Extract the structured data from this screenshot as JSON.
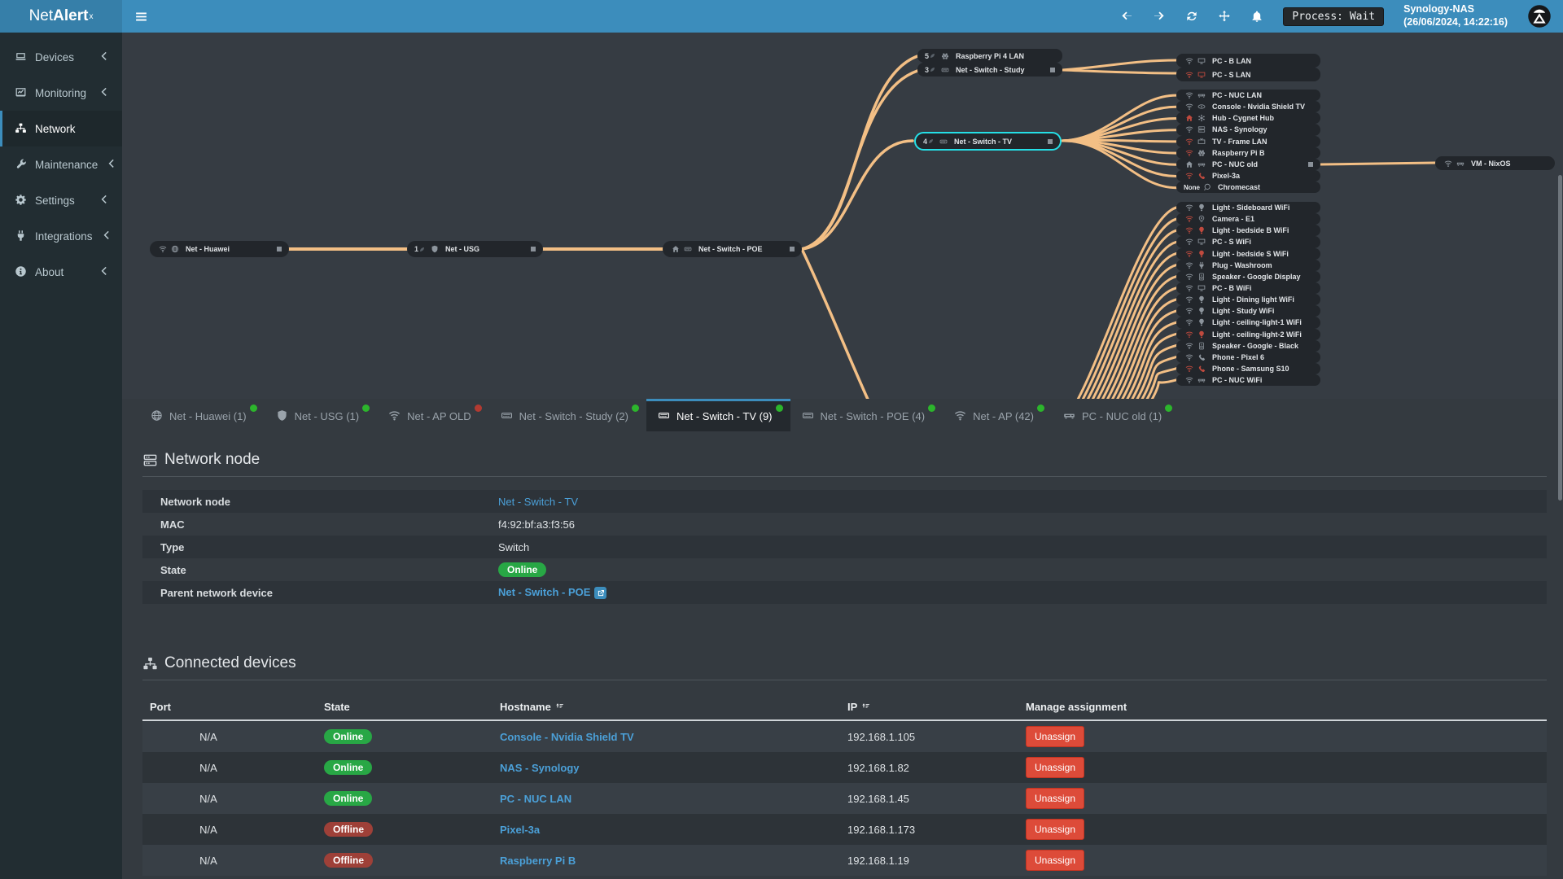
{
  "colors": {
    "accent": "#3c8dbc",
    "edge": "#f3bf85",
    "online": "#28a745",
    "offline": "#9e4038",
    "danger": "#dd4b39",
    "selection": "#25dfe6"
  },
  "topbar": {
    "brand_pre": "Net",
    "brand_bold": "Alert",
    "brand_sup": "x",
    "process_status": "Process: Wait",
    "host_name": "Synology-NAS",
    "host_time": "(26/06/2024, 14:22:16)"
  },
  "sidebar": {
    "items": [
      {
        "label": "Devices",
        "icon": "laptop",
        "chevron": true
      },
      {
        "label": "Monitoring",
        "icon": "chart",
        "chevron": true
      },
      {
        "label": "Network",
        "icon": "sitemap",
        "active_class": "active"
      },
      {
        "label": "Maintenance",
        "icon": "wrench",
        "chevron": true
      },
      {
        "label": "Settings",
        "icon": "gear",
        "chevron": true
      },
      {
        "label": "Integrations",
        "icon": "plug",
        "chevron": true
      },
      {
        "label": "About",
        "icon": "info",
        "chevron": true
      }
    ]
  },
  "diagram": {
    "huawei": {
      "label": "Net - Huawei"
    },
    "usg": {
      "count": "1",
      "label": "Net - USG"
    },
    "poe": {
      "label": "Net - Switch - POE"
    },
    "study_rows": [
      {
        "count": "5",
        "icon": "raspberry",
        "icon_class": "ok",
        "label": "Raspberry Pi 4 LAN"
      },
      {
        "count": "3",
        "icon": "switch",
        "icon_class": "ok",
        "label": "Net - Switch - Study",
        "handle": true
      }
    ],
    "tv": {
      "count": "4",
      "label": "Net - Switch - TV"
    },
    "vm": {
      "label": "VM - NixOS"
    },
    "pcbs_rows": [
      {
        "conn_icon": "wifi",
        "conn_class": "ok",
        "icon": "desktop",
        "icon_class": "ok",
        "label": "PC - B LAN"
      },
      {
        "conn_icon": "wifi",
        "conn_class": "bad",
        "icon": "desktop",
        "icon_class": "bad",
        "label": "PC - S LAN"
      }
    ],
    "tv_children": [
      {
        "conn_icon": "wifi",
        "conn_class": "ok",
        "icon": "nuc",
        "icon_class": "ok",
        "label": "PC - NUC LAN"
      },
      {
        "conn_icon": "wifi",
        "conn_class": "ok",
        "icon": "console",
        "icon_class": "ok",
        "label": "Console - Nvidia Shield TV"
      },
      {
        "conn_icon": "home",
        "conn_class": "bad",
        "icon": "hub",
        "icon_class": "ok",
        "label": "Hub - Cygnet Hub"
      },
      {
        "conn_icon": "wifi",
        "conn_class": "ok",
        "icon": "server",
        "icon_class": "ok",
        "label": "NAS - Synology"
      },
      {
        "conn_icon": "wifi",
        "conn_class": "bad",
        "icon": "tv",
        "icon_class": "ok",
        "label": "TV - Frame LAN"
      },
      {
        "conn_icon": "wifi",
        "conn_class": "bad",
        "icon": "raspberry",
        "icon_class": "ok",
        "label": "Raspberry Pi B"
      },
      {
        "conn_icon": "home",
        "conn_class": "ok",
        "icon": "nuc",
        "icon_class": "ok",
        "label": "PC - NUC old",
        "handle": true
      },
      {
        "conn_icon": "wifi",
        "conn_class": "bad",
        "icon": "phone",
        "icon_class": "bad",
        "label": "Pixel-3a"
      },
      {
        "conn_none": "None",
        "icon": "chromecast",
        "icon_class": "ok",
        "label": "Chromecast"
      }
    ],
    "wifi_children": [
      {
        "conn_icon": "wifi",
        "conn_class": "ok",
        "icon": "bulb",
        "icon_class": "ok",
        "label": "Light - Sideboard WiFi"
      },
      {
        "conn_icon": "wifi",
        "conn_class": "bad",
        "icon": "camera",
        "icon_class": "ok",
        "label": "Camera - E1"
      },
      {
        "conn_icon": "wifi",
        "conn_class": "bad",
        "icon": "bulb",
        "icon_class": "bad",
        "label": "Light - bedside B WiFi"
      },
      {
        "conn_icon": "wifi",
        "conn_class": "ok",
        "icon": "desktop",
        "icon_class": "ok",
        "label": "PC - S WiFi"
      },
      {
        "conn_icon": "wifi",
        "conn_class": "bad",
        "icon": "bulb",
        "icon_class": "bad",
        "label": "Light - bedside S WiFi"
      },
      {
        "conn_icon": "wifi",
        "conn_class": "ok",
        "icon": "plug",
        "icon_class": "ok",
        "label": "Plug - Washroom"
      },
      {
        "conn_icon": "wifi",
        "conn_class": "ok",
        "icon": "speaker",
        "icon_class": "ok",
        "label": "Speaker - Google Display"
      },
      {
        "conn_icon": "wifi",
        "conn_class": "ok",
        "icon": "desktop",
        "icon_class": "ok",
        "label": "PC - B WiFi"
      },
      {
        "conn_icon": "wifi",
        "conn_class": "ok",
        "icon": "bulb",
        "icon_class": "ok",
        "label": "Light - Dining light WiFi"
      },
      {
        "conn_icon": "wifi",
        "conn_class": "ok",
        "icon": "bulb",
        "icon_class": "ok",
        "label": "Light - Study WiFi"
      },
      {
        "conn_icon": "wifi",
        "conn_class": "ok",
        "icon": "bulb",
        "icon_class": "ok",
        "label": "Light - ceiling-light-1 WiFi"
      },
      {
        "conn_icon": "wifi",
        "conn_class": "bad",
        "icon": "bulb",
        "icon_class": "bad",
        "label": "Light - ceiling-light-2 WiFi"
      },
      {
        "conn_icon": "wifi",
        "conn_class": "ok",
        "icon": "speaker",
        "icon_class": "ok",
        "label": "Speaker - Google - Black"
      },
      {
        "conn_icon": "wifi",
        "conn_class": "ok",
        "icon": "phone",
        "icon_class": "ok",
        "label": "Phone - Pixel 6"
      },
      {
        "conn_icon": "wifi",
        "conn_class": "bad",
        "icon": "phone",
        "icon_class": "bad",
        "label": "Phone - Samsung S10"
      },
      {
        "conn_icon": "wifi",
        "conn_class": "ok",
        "icon": "nuc",
        "icon_class": "ok",
        "label": "PC - NUC WiFi"
      }
    ]
  },
  "tabs": [
    {
      "icon": "globe",
      "label": "Net - Huawei (1)",
      "dot": "green"
    },
    {
      "icon": "shield",
      "label": "Net - USG (1)",
      "dot": "green"
    },
    {
      "icon": "wifi",
      "label": "Net - AP OLD",
      "dot": "red"
    },
    {
      "icon": "switch",
      "label": "Net - Switch - Study (2)",
      "dot": "green"
    },
    {
      "icon": "switch",
      "label": "Net - Switch - TV (9)",
      "dot": "green",
      "active_class": "active"
    },
    {
      "icon": "switch",
      "label": "Net - Switch - POE (4)",
      "dot": "green"
    },
    {
      "icon": "wifi",
      "label": "Net - AP (42)",
      "dot": "green"
    },
    {
      "icon": "nuc",
      "label": "PC - NUC old (1)",
      "dot": "green"
    }
  ],
  "node_info": {
    "title": "Network node",
    "rows": [
      {
        "label": "Network node",
        "value": "Net - Switch - TV"
      },
      {
        "label": "MAC",
        "value": "f4:92:bf:a3:f3:56"
      },
      {
        "label": "Type",
        "value": "Switch"
      },
      {
        "label": "State",
        "value": "Online"
      },
      {
        "label": "Parent network device",
        "value": "Net - Switch - POE"
      }
    ]
  },
  "connected": {
    "title": "Connected devices",
    "columns": {
      "port": "Port",
      "state": "State",
      "hostname": "Hostname",
      "ip": "IP",
      "manage": "Manage assignment"
    },
    "rows": [
      {
        "port": "N/A",
        "state": "Online",
        "state_class": "ok",
        "hostname": "Console - Nvidia Shield TV",
        "ip": "192.168.1.105",
        "action": "Unassign"
      },
      {
        "port": "N/A",
        "state": "Online",
        "state_class": "ok",
        "hostname": "NAS - Synology",
        "ip": "192.168.1.82",
        "action": "Unassign"
      },
      {
        "port": "N/A",
        "state": "Online",
        "state_class": "ok",
        "hostname": "PC - NUC LAN",
        "ip": "192.168.1.45",
        "action": "Unassign"
      },
      {
        "port": "N/A",
        "state": "Offline",
        "state_class": "bad",
        "hostname": "Pixel-3a",
        "ip": "192.168.1.173",
        "action": "Unassign"
      },
      {
        "port": "N/A",
        "state": "Offline",
        "state_class": "bad",
        "hostname": "Raspberry Pi B",
        "ip": "192.168.1.19",
        "action": "Unassign"
      }
    ]
  }
}
